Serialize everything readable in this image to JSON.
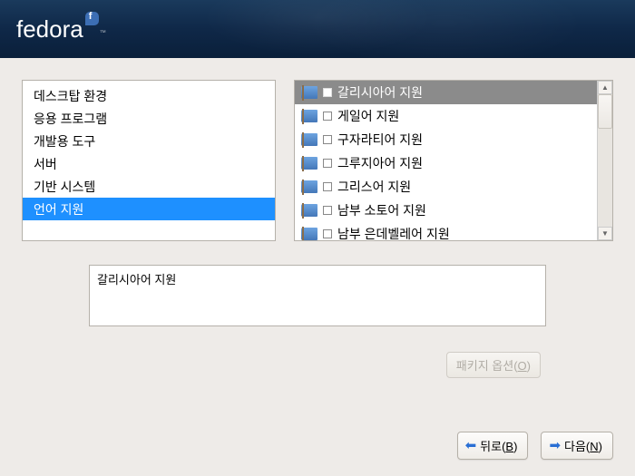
{
  "brand": {
    "name": "fedora"
  },
  "categories": {
    "items": [
      {
        "label": "데스크탑 환경",
        "selected": false
      },
      {
        "label": "응용 프로그램",
        "selected": false
      },
      {
        "label": "개발용 도구",
        "selected": false
      },
      {
        "label": "서버",
        "selected": false
      },
      {
        "label": "기반 시스템",
        "selected": false
      },
      {
        "label": "언어 지원",
        "selected": true
      }
    ],
    "selected_index": 5
  },
  "subcategories": {
    "items": [
      {
        "label": "갈리시아어 지원",
        "checked": true,
        "selected": true
      },
      {
        "label": "게일어 지원",
        "checked": false,
        "selected": false
      },
      {
        "label": "구자라티어 지원",
        "checked": false,
        "selected": false
      },
      {
        "label": "그루지아어 지원",
        "checked": false,
        "selected": false
      },
      {
        "label": "그리스어 지원",
        "checked": false,
        "selected": false
      },
      {
        "label": "남부 소토어 지원",
        "checked": false,
        "selected": false
      },
      {
        "label": "남부 은데벨레어 지원",
        "checked": false,
        "selected": false
      }
    ]
  },
  "description": {
    "text": "갈리시아어 지원"
  },
  "buttons": {
    "package_options": {
      "label": "패키지 옵션(",
      "mnemonic": "O",
      "suffix": ")",
      "enabled": false
    },
    "back": {
      "label": "뒤로(",
      "mnemonic": "B",
      "suffix": ")"
    },
    "next": {
      "label": "다음(",
      "mnemonic": "N",
      "suffix": ")"
    }
  }
}
